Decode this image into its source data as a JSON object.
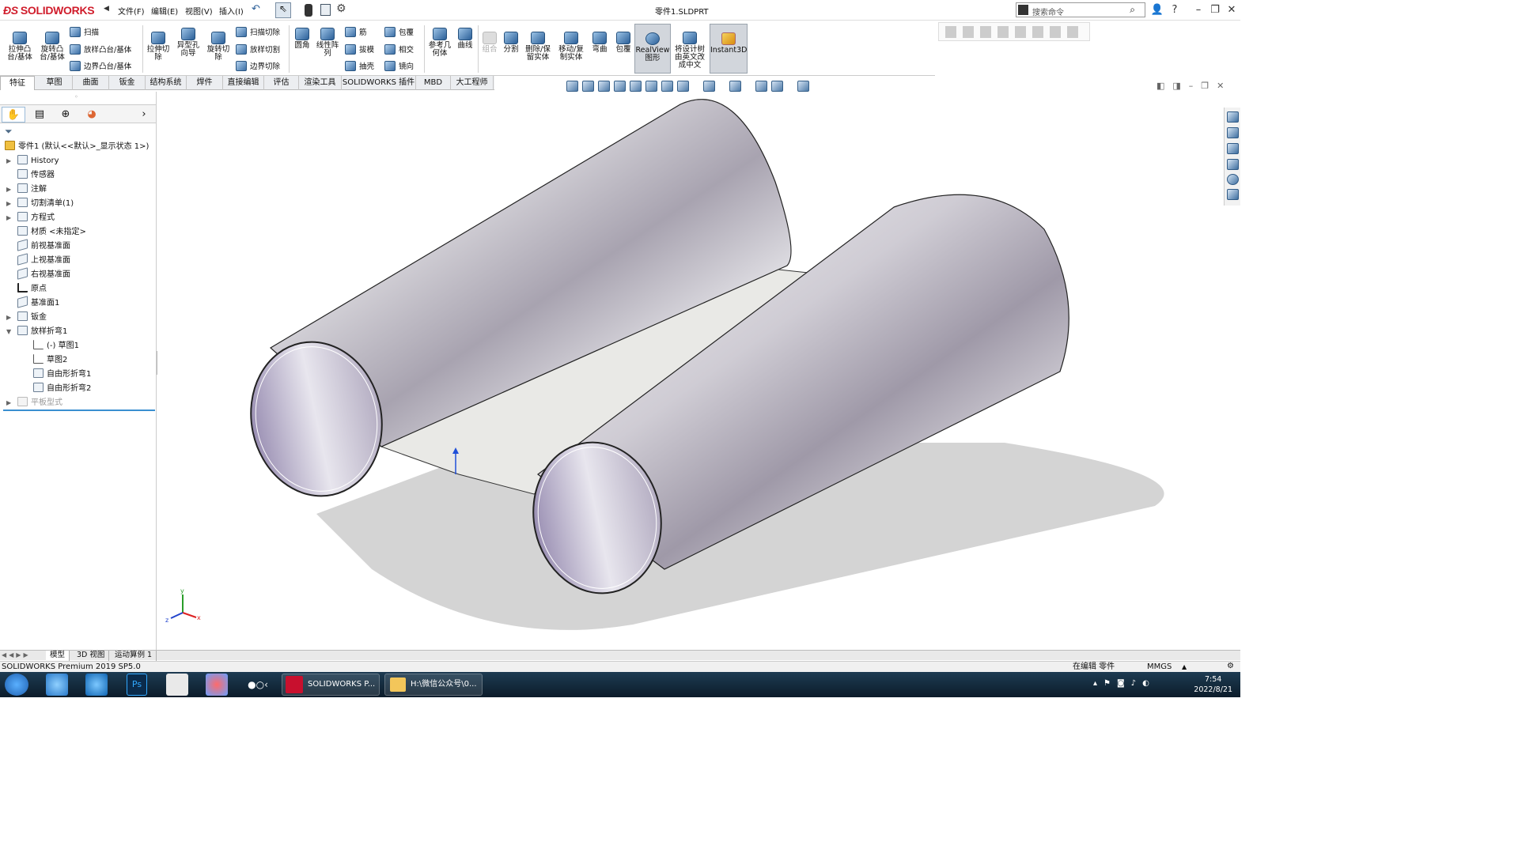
{
  "app": {
    "brand": "SOLIDWORKS",
    "document_title": "零件1.SLDPRT"
  },
  "menu": [
    "文件(F)",
    "编辑(E)",
    "视图(V)",
    "插入(I)"
  ],
  "search": {
    "placeholder": "搜索命令"
  },
  "ribbon": {
    "extrude_boss": "拉伸凸\n台/基体",
    "revolve_boss": "旋转凸\n台/基体",
    "sweep": "扫描",
    "loft_boss": "放样凸台/基体",
    "boundary_boss": "边界凸台/基体",
    "extrude_cut": "拉伸切\n除",
    "hole_wizard": "异型孔\n向导",
    "revolve_cut": "旋转切\n除",
    "swept_cut": "扫描切除",
    "lofted_cut": "放样切割",
    "boundary_cut": "边界切除",
    "fillet": "圆角",
    "linear_pattern": "线性阵\n列",
    "rib": "筋",
    "draft": "拔模",
    "shell": "抽壳",
    "wrap": "包覆",
    "intersect": "相交",
    "mirror": "镜向",
    "ref_geometry": "参考几\n何体",
    "curves": "曲线",
    "combine": "组合",
    "split": "分割",
    "delete_keep_body": "删除/保\n留实体",
    "move_copy_body": "移动/复\n制实体",
    "flex": "弯曲",
    "wrap2": "包覆",
    "realview": "RealView\n图形",
    "translate_tree": "将设计树\n由英文改\n成中文",
    "instant3d": "Instant3D"
  },
  "tabs": [
    "特征",
    "草图",
    "曲面",
    "钣金",
    "结构系统",
    "焊件",
    "直接编辑",
    "评估",
    "渲染工具",
    "SOLIDWORKS 插件",
    "MBD",
    "大工程师"
  ],
  "tree": {
    "root": "零件1 (默认<<默认>_显示状态 1>)",
    "items": [
      "History",
      "传感器",
      "注解",
      "切割清单(1)",
      "方程式",
      "材质 <未指定>",
      "前视基准面",
      "上视基准面",
      "右视基准面",
      "原点",
      "基准面1",
      "钣金",
      "放样折弯1",
      "(-) 草图1",
      "草图2",
      "自由形折弯1",
      "自由形折弯2",
      "平板型式"
    ]
  },
  "bottom_tabs": [
    "模型",
    "3D 视图",
    "运动算例 1"
  ],
  "status": {
    "version": "SOLIDWORKS Premium 2019 SP5.0",
    "mode": "在编辑 零件",
    "units": "MMGS"
  },
  "taskbar": {
    "sw_label": "SOLIDWORKS P...",
    "folder_label": "H:\\微信公众号\\0...",
    "time": "7:54",
    "date": "2022/8/21"
  },
  "triad": {
    "x": "x",
    "y": "y",
    "z": "z"
  }
}
